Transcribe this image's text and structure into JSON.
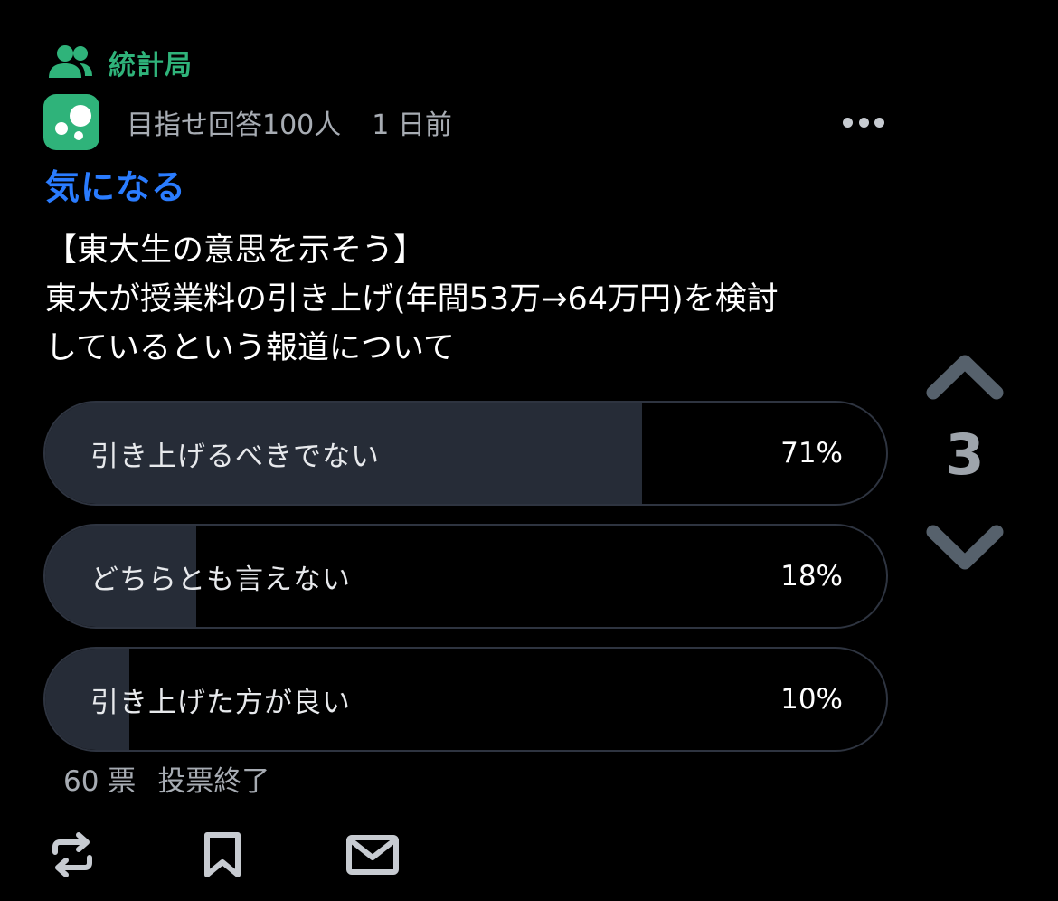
{
  "community": {
    "name": "統計局",
    "icon": "people-icon",
    "color": "#2fb37a"
  },
  "post": {
    "author": "目指せ回答100人",
    "time": "1 日前",
    "tag": "気になる",
    "tag_color": "#2a7cff",
    "body_lines": [
      "【東大生の意思を示そう】",
      "東大が授業料の引き上げ(年間53万→64万円)を検討",
      "しているという報道について"
    ]
  },
  "poll": {
    "options": [
      {
        "label": "引き上げるべきでない",
        "percent_text": "71%",
        "percent": 71
      },
      {
        "label": "どちらとも言えない",
        "percent_text": "18%",
        "percent": 18
      },
      {
        "label": "引き上げた方が良い",
        "percent_text": "10%",
        "percent": 10
      }
    ],
    "votes": "60 票",
    "status": "投票終了"
  },
  "vote": {
    "score": "3"
  },
  "icons": {
    "more": "more-dots-icon",
    "upvote": "chevron-up-icon",
    "downvote": "chevron-down-icon",
    "repost": "repost-icon",
    "bookmark": "bookmark-icon",
    "message": "mail-icon"
  }
}
